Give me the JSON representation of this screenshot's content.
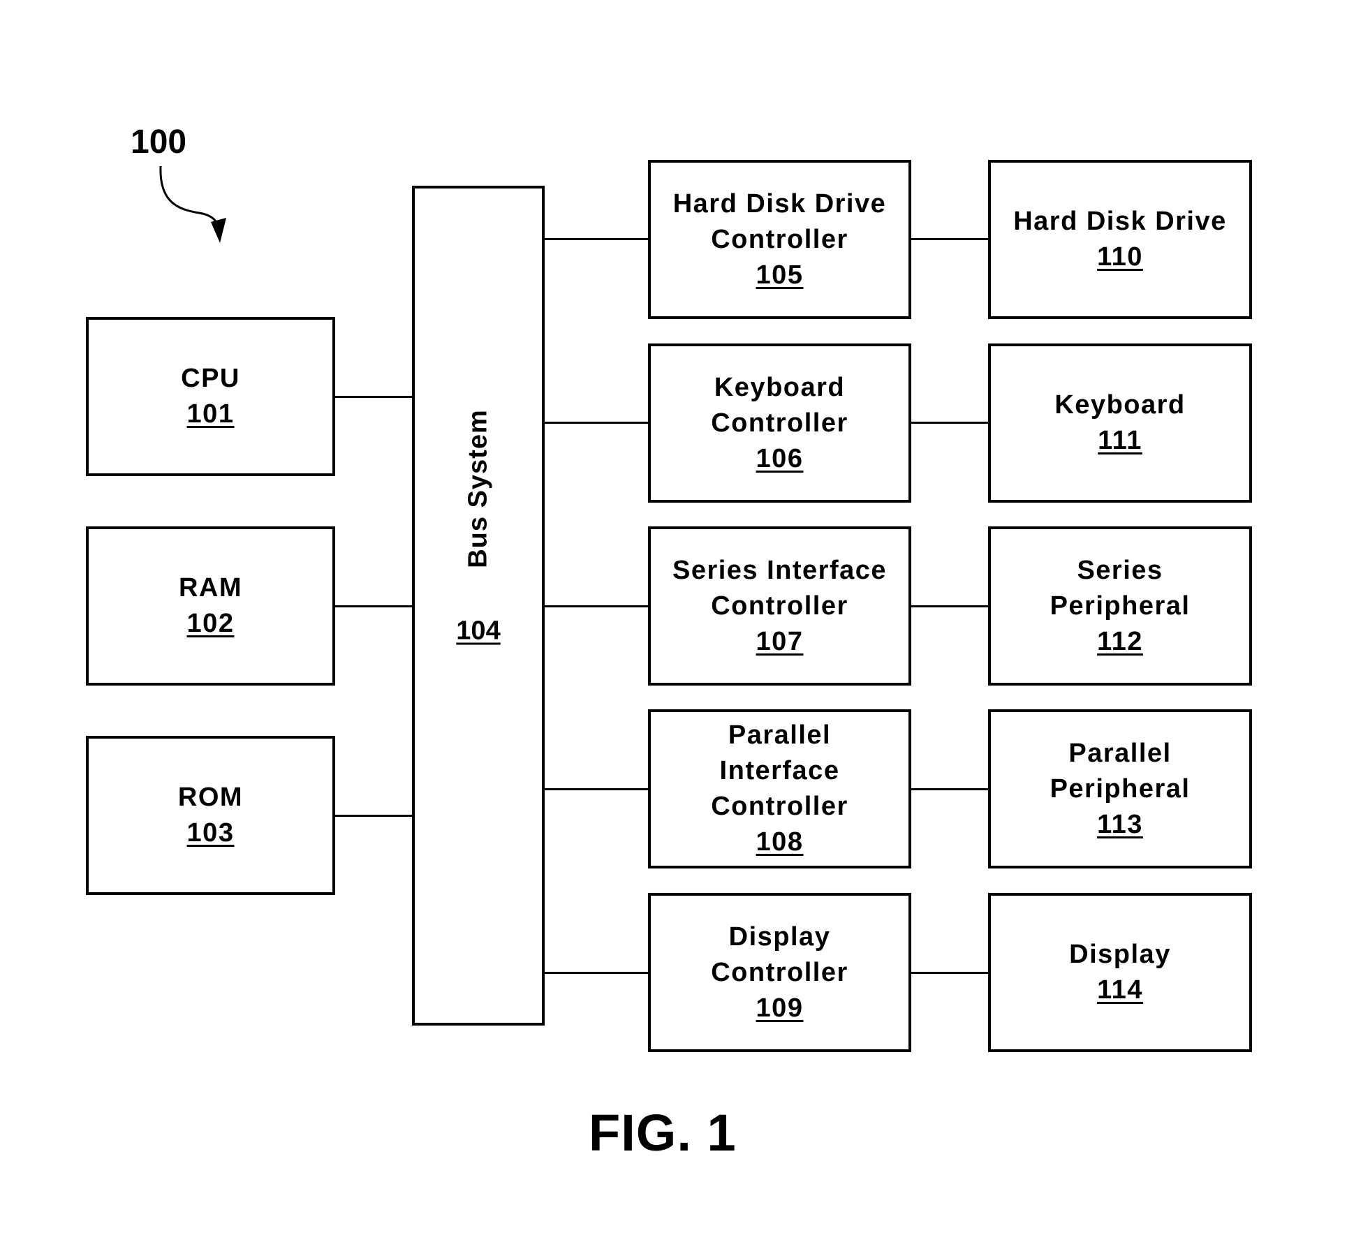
{
  "figure": {
    "reference_number": "100",
    "caption": "FIG. 1"
  },
  "bus": {
    "label": "Bus System",
    "number": "104"
  },
  "left_components": [
    {
      "label": "CPU",
      "number": "101"
    },
    {
      "label": "RAM",
      "number": "102"
    },
    {
      "label": "ROM",
      "number": "103"
    }
  ],
  "controllers": [
    {
      "lines": [
        "Hard Disk Drive",
        "Controller"
      ],
      "number": "105"
    },
    {
      "lines": [
        "Keyboard",
        "Controller"
      ],
      "number": "106"
    },
    {
      "lines": [
        "Series Interface",
        "Controller"
      ],
      "number": "107"
    },
    {
      "lines": [
        "Parallel",
        "Interface",
        "Controller"
      ],
      "number": "108"
    },
    {
      "lines": [
        "Display",
        "Controller"
      ],
      "number": "109"
    }
  ],
  "peripherals": [
    {
      "lines": [
        "Hard Disk Drive"
      ],
      "number": "110"
    },
    {
      "lines": [
        "Keyboard"
      ],
      "number": "111"
    },
    {
      "lines": [
        "Series",
        "Peripheral"
      ],
      "number": "112"
    },
    {
      "lines": [
        "Parallel",
        "Peripheral"
      ],
      "number": "113"
    },
    {
      "lines": [
        "Display"
      ],
      "number": "114"
    }
  ]
}
